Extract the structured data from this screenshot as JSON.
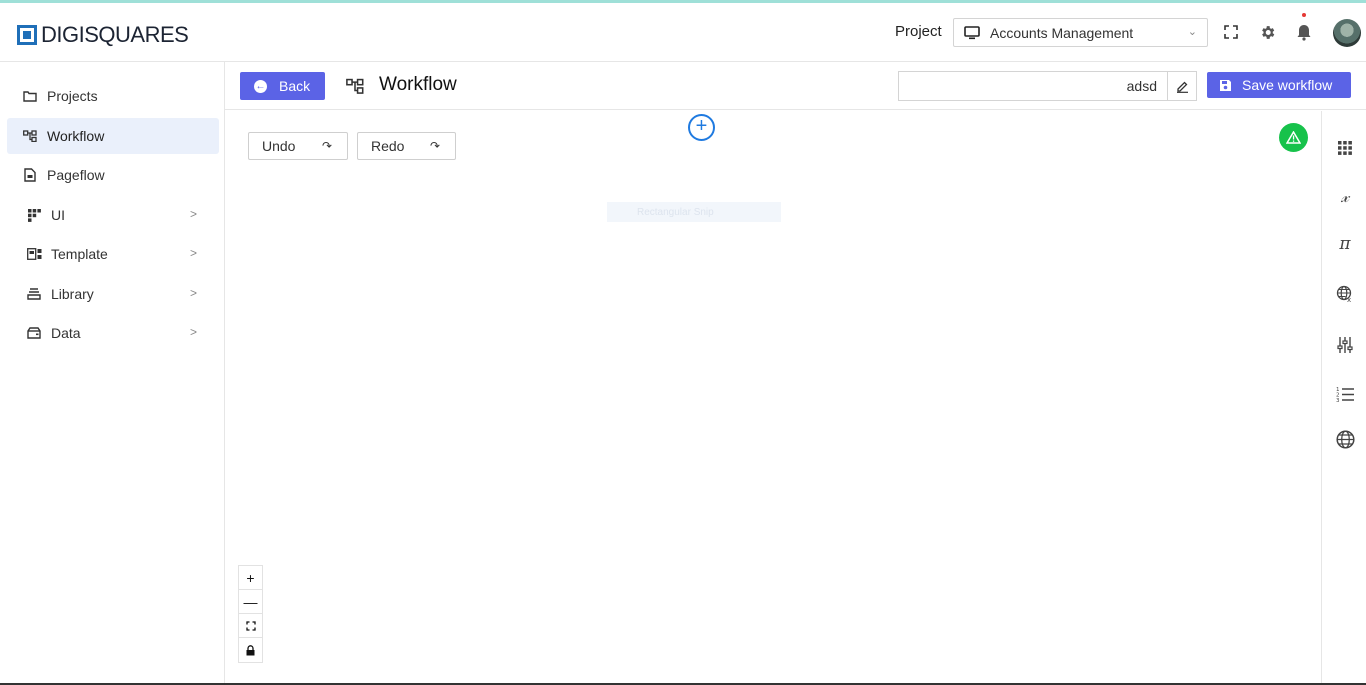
{
  "header": {
    "brand": "DIGISQUARES",
    "project_label": "Project",
    "project_value": "Accounts Management",
    "icons": [
      "monitor-icon",
      "chevron-down-icon",
      "fullscreen-icon",
      "gear-icon",
      "bell-icon",
      "avatar"
    ]
  },
  "sidebar": {
    "items": [
      {
        "label": "Projects",
        "icon": "folder-icon"
      },
      {
        "label": "Workflow",
        "icon": "workflow-icon",
        "active": true
      },
      {
        "label": "Pageflow",
        "icon": "page-icon"
      },
      {
        "label": "UI",
        "icon": "grid-icon",
        "expandable": true
      },
      {
        "label": "Template",
        "icon": "template-icon",
        "expandable": true
      },
      {
        "label": "Library",
        "icon": "library-icon",
        "expandable": true
      },
      {
        "label": "Data",
        "icon": "database-icon",
        "expandable": true
      }
    ]
  },
  "toolbar": {
    "back_label": "Back",
    "title": "Workflow",
    "name_value": "adsd",
    "save_label": "Save workflow"
  },
  "canvas": {
    "undo_label": "Undo",
    "redo_label": "Redo",
    "node_hint": "Rectangular Snip",
    "zoom_in": "+",
    "zoom_out": "—",
    "warning_icon": "warning-icon"
  },
  "rail": {
    "icons": [
      "apps-icon",
      "variable-icon",
      "pi-icon",
      "global-variable-icon",
      "sliders-icon",
      "numbered-list-icon",
      "globe-icon"
    ]
  },
  "colors": {
    "primary": "#5b63e6",
    "brand": "#1f6fb8",
    "success": "#17c24b",
    "active_bg": "#eaf0fb"
  }
}
